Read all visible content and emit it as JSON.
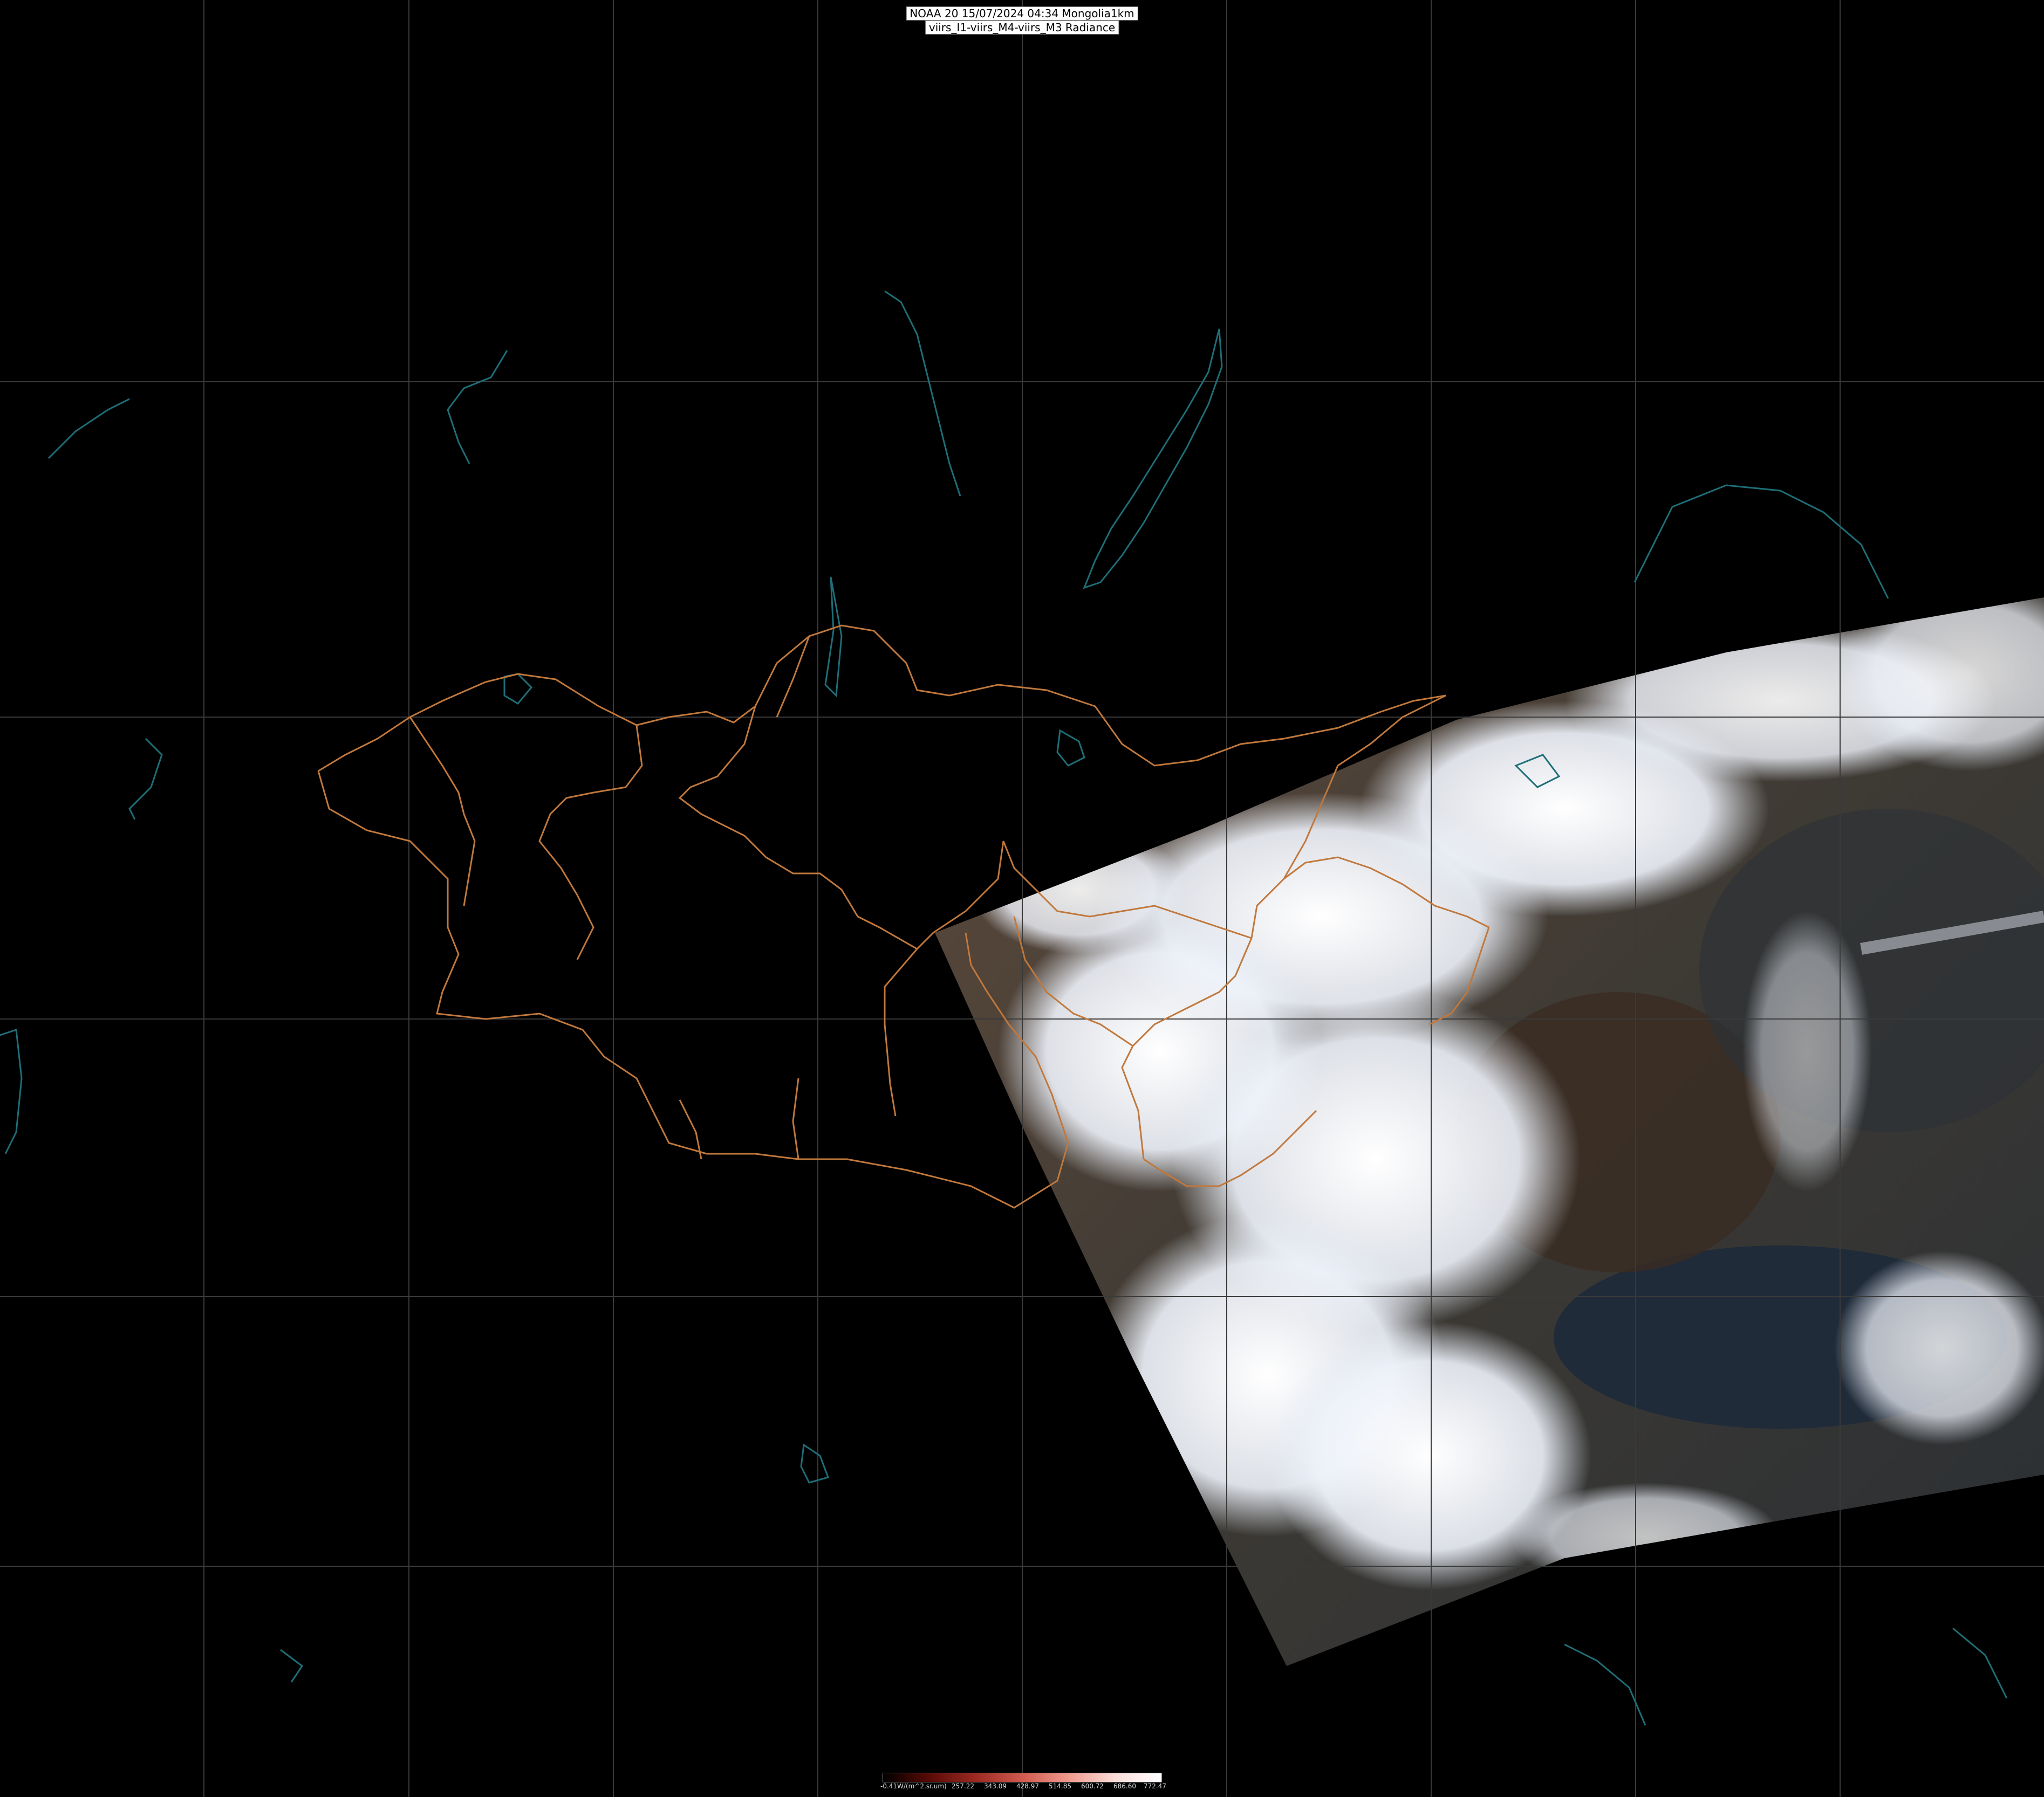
{
  "title": {
    "line1": "NOAA 20 15/07/2024 04:34 Mongolia1km",
    "line2": "viirs_I1-viirs_M4-viirs_M3 Radiance"
  },
  "legend": {
    "unit_label": "-0.41W/(m^2.sr.um)",
    "ticks": [
      "257.22",
      "343.09",
      "428.97",
      "514.85",
      "600.72",
      "686.60",
      "772.47"
    ],
    "gradient_colors": [
      "#000000",
      "#5a0a06",
      "#9b2a22",
      "#d25a4e",
      "#ef9a8f",
      "#fadcd8",
      "#ffffff"
    ]
  },
  "map_style": {
    "background": "#000000",
    "graticule_color": "#3a3a3a",
    "border_color": "#c0783c",
    "coast_color": "#1e6e78",
    "cloud_color": "#f2f5fb",
    "land_color": "#5a4636"
  }
}
